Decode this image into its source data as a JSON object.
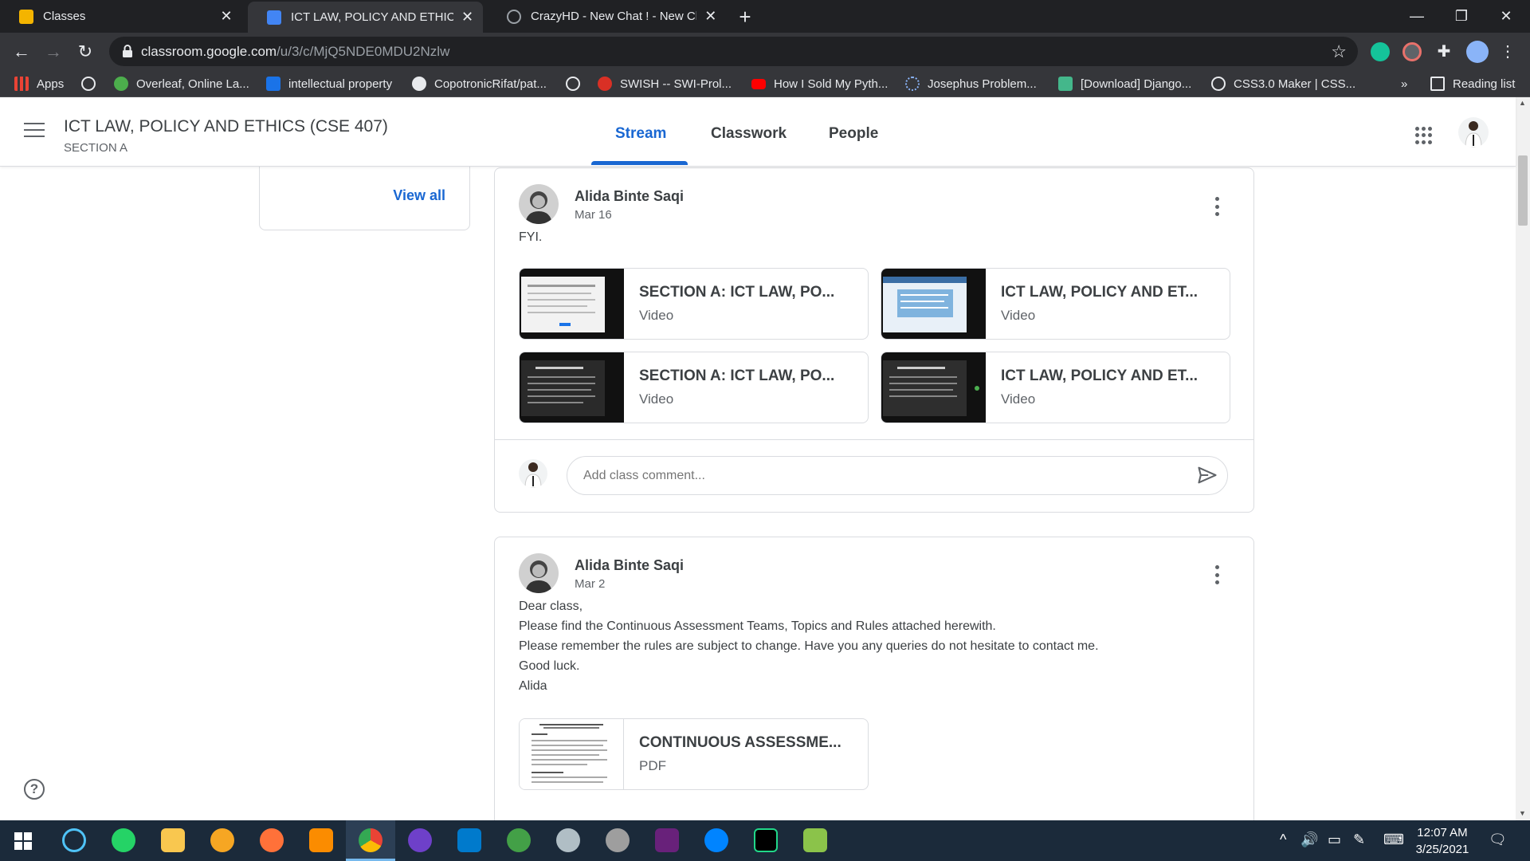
{
  "browser": {
    "tabs": [
      {
        "title": "Classes",
        "active": false,
        "color": "#f4b400"
      },
      {
        "title": "ICT LAW, POLICY AND ETHICS (C",
        "active": true,
        "color": "#4285f4"
      },
      {
        "title": "CrazyHD - New Chat ! - New Cha",
        "active": false,
        "color": "#9aa0a6"
      }
    ],
    "url_main": "classroom.google.com",
    "url_path": "/u/3/c/MjQ5NDE0MDU2Nzlw",
    "bookmarks": [
      {
        "label": "Apps",
        "icon": "apps-grid-icon",
        "color": "#ea4335"
      },
      {
        "label": "",
        "icon": "globe-icon",
        "color": "#e8eaed"
      },
      {
        "label": "Overleaf, Online La...",
        "icon": "overleaf-icon",
        "color": "#4cae4c"
      },
      {
        "label": "intellectual property",
        "icon": "bookmark-s-icon",
        "color": "#1a73e8"
      },
      {
        "label": "CopotronicRifat/pat...",
        "icon": "github-icon",
        "color": "#e8eaed"
      },
      {
        "label": "",
        "icon": "globe-icon",
        "color": "#e8eaed"
      },
      {
        "label": "SWISH -- SWI-Prol...",
        "icon": "swish-icon",
        "color": "#d93025"
      },
      {
        "label": "How I Sold My Pyth...",
        "icon": "youtube-icon",
        "color": "#ff0000"
      },
      {
        "label": "Josephus Problem...",
        "icon": "loading-icon",
        "color": "#8ab4f8"
      },
      {
        "label": "[Download] Django...",
        "icon": "django-icon",
        "color": "#44b78b"
      },
      {
        "label": "CSS3.0 Maker | CSS...",
        "icon": "globe-icon",
        "color": "#e8eaed"
      }
    ],
    "more_bookmarks": "»",
    "reading_list": "Reading list"
  },
  "classroom": {
    "class_title": "ICT LAW, POLICY AND ETHICS (CSE 407)",
    "section": "SECTION A",
    "tabs": [
      "Stream",
      "Classwork",
      "People"
    ],
    "active_tab": "Stream",
    "view_all": "View all",
    "posts": [
      {
        "author": "Alida Binte Saqi",
        "date": "Mar 16",
        "body": [
          "FYI."
        ],
        "attachments": [
          {
            "title": "SECTION A: ICT LAW, PO...",
            "type": "Video"
          },
          {
            "title": "ICT LAW, POLICY AND ET...",
            "type": "Video"
          },
          {
            "title": "SECTION A: ICT LAW, PO...",
            "type": "Video"
          },
          {
            "title": "ICT LAW, POLICY AND ET...",
            "type": "Video"
          }
        ],
        "comment_placeholder": "Add class comment..."
      },
      {
        "author": "Alida Binte Saqi",
        "date": "Mar 2",
        "body": [
          "Dear class,",
          "Please find the Continuous Assessment Teams, Topics and Rules attached herewith.",
          "Please remember the rules are subject to change. Have you any queries do not hesitate to contact me.",
          "Good luck.",
          "Alida"
        ],
        "attachments": [
          {
            "title": "CONTINUOUS ASSESSME...",
            "type": "PDF"
          }
        ]
      }
    ],
    "accent_color": "#1967d2"
  },
  "taskbar": {
    "time": "12:07 AM",
    "date": "3/25/2021"
  }
}
